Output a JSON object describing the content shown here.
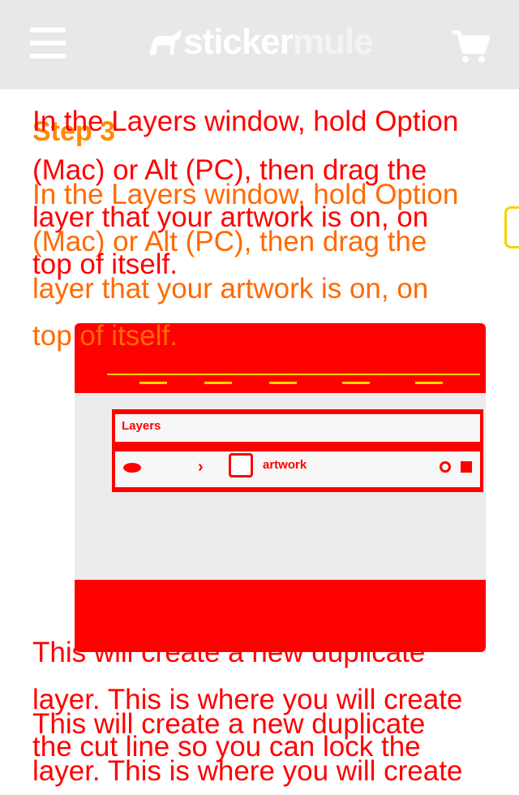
{
  "header": {
    "menu_icon": "hamburger-menu-icon",
    "logo_word1": "sticker",
    "logo_word2": "mule",
    "cart_icon": "shopping-cart-icon"
  },
  "content": {
    "step_title": "Step 3",
    "para1_lines": [
      "In the Layers window, hold Option",
      "(Mac) or Alt (PC), then drag the",
      "layer that your artwork is on, on",
      "top of itself."
    ],
    "layers_panel": {
      "title": "Layers",
      "layer_name": "artwork"
    },
    "para2_lines": [
      "This will create a new duplicate",
      "layer. This is where you will create",
      "the cut line so you can lock the"
    ]
  },
  "colors": {
    "header_bg": "#e8e8e8",
    "text_red": "#ff0000",
    "text_orange": "#ff6a00",
    "step_orange": "#ff8a00"
  }
}
